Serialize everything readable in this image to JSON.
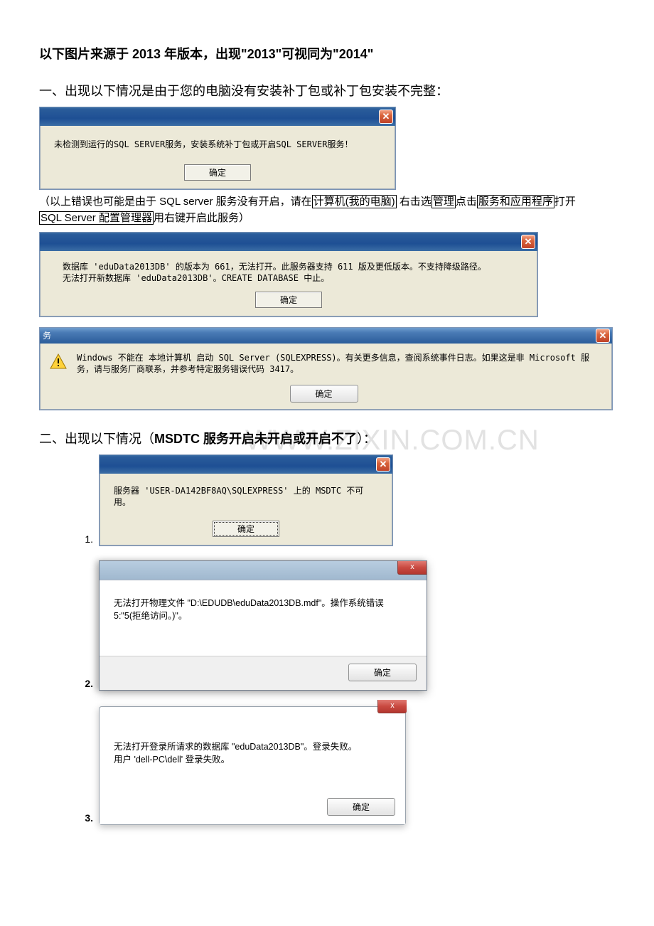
{
  "heading_main": "以下图片来源于 2013 年版本，出现\"2013\"可视同为\"2014\"",
  "section1_title": "一、出现以下情况是由于您的电脑没有安装补丁包或补丁包安装不完整：",
  "dlg1_text": "未检测到运行的SQL SERVER服务，安装系统补丁包或开启SQL SERVER服务！",
  "ok_label": "确定",
  "close_glyph": "✕",
  "close_glyph_alt": "x",
  "note1_prefix": "（以上错误也可能是由于 SQL server 服务没有开启，请在",
  "note1_box1": "计算机(我的电脑)",
  "note1_mid1": " 右击选",
  "note1_box2": "管理",
  "note1_mid2": "点击",
  "note1_box3": "服务和应用程序",
  "note1_mid3": "打开",
  "note1_box4": "SQL Server 配置管理器",
  "note1_suffix": "用右键开启此服务）",
  "dlg2_line1": "数据库 'eduData2013DB' 的版本为 661，无法打开。此服务器支持 611 版及更低版本。不支持降级路径。",
  "dlg2_line2": "无法打开新数据库 'eduData2013DB'。CREATE DATABASE 中止。",
  "dlg3_partial_title": "务",
  "dlg3_text": "Windows 不能在 本地计算机 启动 SQL Server (SQLEXPRESS)。有关更多信息，查阅系统事件日志。如果这是非 Microsoft 服务，请与服务厂商联系，并参考特定服务错误代码 3417。",
  "section2_title_a": "二、出现以下情况（",
  "section2_title_b": "MSDTC 服务开启未开启或开启不了",
  "section2_title_c": "）：",
  "watermark_text": "WWW.ZIXIN.COM.CN",
  "list1_num": "1.",
  "list2_num": "2.",
  "list3_num": "3.",
  "dlg4_text": "服务器 'USER-DA142BF8AQ\\SQLEXPRESS' 上的 MSDTC 不可用。",
  "dlg5_text": "无法打开物理文件 \"D:\\EDUDB\\eduData2013DB.mdf\"。操作系统错误 5:\"5(拒绝访问。)\"。",
  "dlg6_line1": "无法打开登录所请求的数据库 \"eduData2013DB\"。登录失败。",
  "dlg6_line2": "用户 'dell-PC\\dell' 登录失败。"
}
